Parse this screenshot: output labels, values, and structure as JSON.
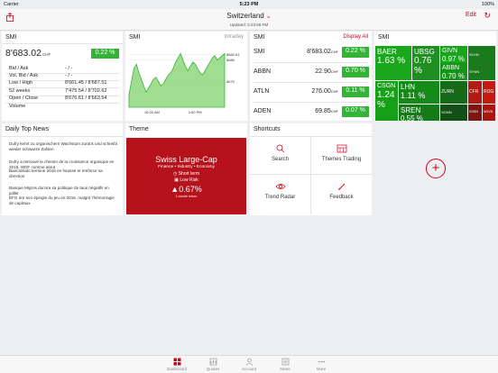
{
  "status_bar": {
    "carrier": "Carrier",
    "time": "5:23 PM",
    "battery": "100%"
  },
  "nav": {
    "title": "Switzerland",
    "updated": "Updated: 5:23:58 PM",
    "edit": "Edit"
  },
  "smi_card": {
    "title": "SMI",
    "price": "8'683.02",
    "currency": "CHF",
    "change": "0.22 %",
    "rows": [
      {
        "label": "Bid / Ask",
        "value": "- / -"
      },
      {
        "label": "Vol. Bid / Ask",
        "value": "- / -"
      },
      {
        "label": "Low / High",
        "value": "8'661.45 / 8'687.51"
      },
      {
        "label": "52 weeks",
        "value": "7'475.54 / 8'702.62"
      },
      {
        "label": "Open / Close",
        "value": "8'676.61 / 8'663.54"
      },
      {
        "label": "Volume",
        "value": ""
      }
    ]
  },
  "intraday": {
    "title": "SMI",
    "mode": "Intraday",
    "y_labels": [
      "8682.61",
      "8680",
      "8670"
    ],
    "x_labels": [
      "10:00 AM",
      "2:00 PM"
    ],
    "series": [
      8664,
      8670,
      8676,
      8678,
      8674,
      8671,
      8668,
      8665,
      8667,
      8669,
      8671,
      8672,
      8670,
      8668,
      8669,
      8671,
      8673,
      8674,
      8676,
      8679,
      8681,
      8683,
      8680,
      8677,
      8675,
      8677,
      8679,
      8678,
      8676,
      8674,
      8673,
      8675,
      8677,
      8679,
      8681,
      8682,
      8680,
      8681,
      8682,
      8683
    ]
  },
  "smi_list": {
    "title": "SMI",
    "action": "Display All",
    "rows": [
      {
        "name": "SMI",
        "value": "8'683.02",
        "unit": "CHF",
        "change": "0.22 %"
      },
      {
        "name": "ABBN",
        "value": "22.90",
        "unit": "CHF",
        "change": "0.70 %"
      },
      {
        "name": "ATLN",
        "value": "276.00",
        "unit": "CHF",
        "change": "0.11 %"
      },
      {
        "name": "ADEN",
        "value": "69.85",
        "unit": "CHF",
        "change": "0.07 %"
      }
    ]
  },
  "heatmap": {
    "title": "SMI",
    "tiles": [
      {
        "name": "BAER",
        "value": "1.63 %",
        "color": "#19a81c"
      },
      {
        "name": "UBSG",
        "value": "0.76 %",
        "color": "#1f8f21"
      },
      {
        "name": "GIVN",
        "value": "0.97 %",
        "color": "#17a51a"
      },
      {
        "name": "ABBN",
        "value": "0.70 %",
        "color": "#16941a"
      },
      {
        "name": "SLHN",
        "value": "",
        "color": "#1b7a1d"
      },
      {
        "name": "SYNN",
        "value": "",
        "color": "#1b7a1d"
      },
      {
        "name": "CSGN",
        "value": "1.24 %",
        "color": "#15a018"
      },
      {
        "name": "LHN",
        "value": "1.11 %",
        "color": "#168a18"
      },
      {
        "name": "ZURN",
        "value": "",
        "color": "#156a17"
      },
      {
        "name": "CFR",
        "value": "",
        "color": "#b01c14"
      },
      {
        "name": "ROG",
        "value": "",
        "color": "#c41a12"
      },
      {
        "name": "SREN",
        "value": "0.55 %",
        "color": "#177a19"
      },
      {
        "name": "SCMN",
        "value": "",
        "color": "#144f15"
      },
      {
        "name": "SGSN",
        "value": "",
        "color": "#7a1712"
      },
      {
        "name": "NOVN",
        "value": "",
        "color": "#a8160f"
      }
    ]
  },
  "news": {
    "title": "Daily Top News",
    "items": [
      "Dufry kehrt zu organischem Wachstum zurück und schreibt wieder schwarze Zahlen",
      "Dufry a retrouvé le chemin de la croissance organique en 2016, WDF comme atout",
      "BancaStato termine 2016 en hausse et renforce sa direction",
      "Banque Migros durcira sa politique de taux négatifs en juillet",
      "EFG rire son épingle du jeu en 2016, malgré l'hémorragie de capitaux"
    ]
  },
  "theme": {
    "title": "Theme",
    "name": "Swiss Large-Cap",
    "tags": "Finance • Industry • Economy",
    "term": "Short term",
    "risk": "Low Risk",
    "return": "0.67%",
    "return_label": "1-month return"
  },
  "shortcuts": {
    "title": "Shortcuts",
    "items": [
      {
        "label": "Search",
        "icon": "search-icon"
      },
      {
        "label": "Themes Trading",
        "icon": "themes-trading-icon"
      },
      {
        "label": "Trend Radar",
        "icon": "trend-radar-icon"
      },
      {
        "label": "Feedback",
        "icon": "feedback-icon"
      }
    ]
  },
  "tabs": [
    {
      "label": "Dashboard",
      "active": true
    },
    {
      "label": "Quotes",
      "active": false
    },
    {
      "label": "Account",
      "active": false
    },
    {
      "label": "News",
      "active": false
    },
    {
      "label": "More",
      "active": false
    }
  ],
  "colors": {
    "accent": "#d0021b",
    "positive": "#35b336"
  }
}
